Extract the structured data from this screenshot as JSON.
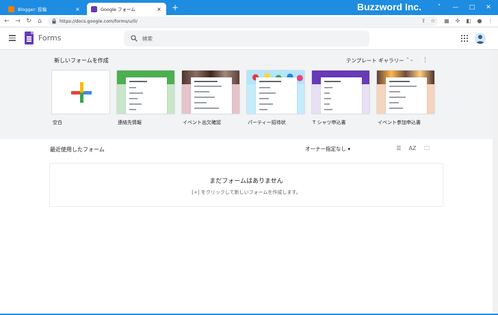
{
  "browser": {
    "tabs": [
      {
        "title": "Blogger: 投稿",
        "favicon_color": "#f57c00",
        "close": "×"
      },
      {
        "title": "Google フォーム",
        "favicon_color": "#673ab7",
        "close": "×"
      }
    ],
    "new_tab": "+",
    "window_title": "Buzzword Inc.",
    "url": "https://docs.google.com/forms/u/0/",
    "nav": {
      "back": "←",
      "forward": "→",
      "reload": "↻",
      "home": "⌂"
    },
    "window_controls": {
      "minimize": "—",
      "maximize": "□",
      "close": "✕",
      "tabsearch": "˅"
    }
  },
  "header": {
    "app_name": "Forms",
    "search_placeholder": "検索"
  },
  "templates": {
    "section_title": "新しいフォームを作成",
    "gallery_label": "テンプレート ギャラリー",
    "gallery_arrows": "⌃⌄",
    "items": [
      {
        "label": "空白",
        "color": "#ffffff",
        "bg": "#ffffff"
      },
      {
        "label": "連絡先情報",
        "color": "#4caf50",
        "bg": "#c8e6c9"
      },
      {
        "label": "イベント出欠確認",
        "color": "#6d4c41",
        "bg": "#e6c3c9"
      },
      {
        "label": "パーティー招待状",
        "color": "#4fc3f7",
        "bg": "#c5ecfb"
      },
      {
        "label": "T シャツ申込書",
        "color": "#673ab7",
        "bg": "#e8e0f4"
      },
      {
        "label": "イベント参加申込書",
        "color": "#8d5a3c",
        "bg": "#f6d4bd"
      }
    ]
  },
  "recent": {
    "title": "最近使用したフォーム",
    "owner_filter": "オーナー指定なし ▾",
    "empty_title": "まだフォームはありません",
    "empty_subtitle": "[+] をクリックして新しいフォームを作成します。"
  },
  "colors": {
    "titlebar": "#1e8ce0",
    "accent": "#673ab7"
  }
}
